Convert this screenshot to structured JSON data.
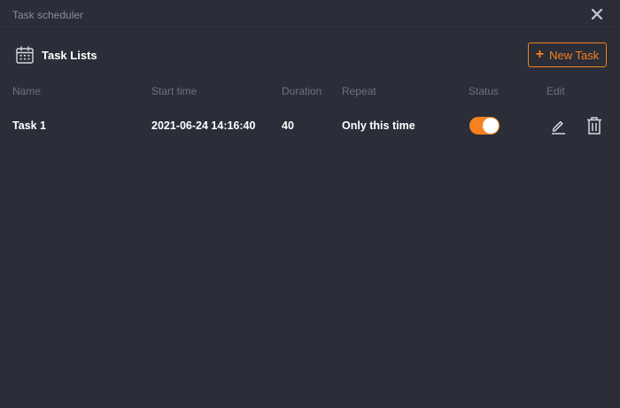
{
  "window": {
    "title": "Task scheduler",
    "close_icon": "close-icon"
  },
  "toolbar": {
    "section_icon": "calendar-icon",
    "section_title": "Task Lists",
    "new_task_label": "New Task",
    "new_task_icon": "plus-icon"
  },
  "table": {
    "columns": [
      "Name",
      "Start time",
      "Duration",
      "Repeat",
      "Status",
      "Edit"
    ],
    "rows": [
      {
        "name": "Task 1",
        "start_time": "2021-06-24 14:16:40",
        "duration": "40",
        "repeat": "Only this time",
        "status_enabled": true,
        "edit_icon": "pencil-icon",
        "delete_icon": "trash-icon"
      }
    ]
  },
  "colors": {
    "background": "#2b2d38",
    "accent": "#f5821f",
    "header_text": "#6e7080",
    "title_text": "#8a8c99",
    "row_text": "#ffffff"
  }
}
